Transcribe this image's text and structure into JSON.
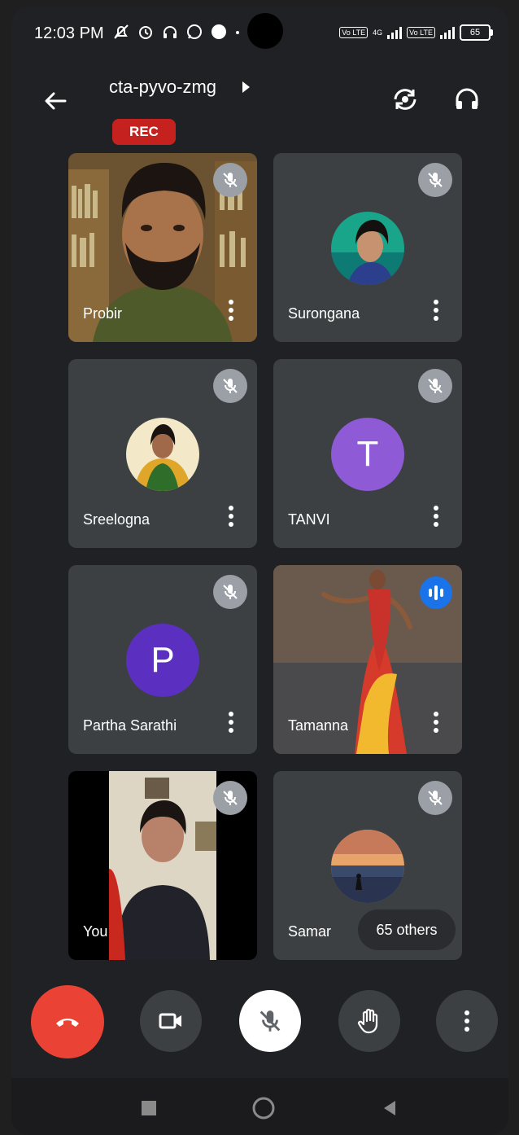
{
  "status_bar": {
    "time": "12:03 PM",
    "network": "4G",
    "lte": "Vo LTE",
    "battery": "65"
  },
  "header": {
    "meeting_code": "cta-pyvo-zmg",
    "rec_label": "REC"
  },
  "participants": [
    {
      "name": "Probir",
      "type": "video",
      "muted": true
    },
    {
      "name": "Surongana",
      "type": "photo",
      "muted": true
    },
    {
      "name": "Sreelogna",
      "type": "photo",
      "muted": true
    },
    {
      "name": "TANVI",
      "type": "letter",
      "letter": "T",
      "color": "#8e5ad6",
      "muted": true
    },
    {
      "name": "Partha Sarathi",
      "type": "letter",
      "letter": "P",
      "color": "#5b2fbf",
      "muted": true
    },
    {
      "name": "Tamanna",
      "type": "video",
      "muted": false,
      "speaking": true
    },
    {
      "name": "You",
      "type": "video",
      "muted": true
    },
    {
      "name": "Samar",
      "type": "photo",
      "muted": true,
      "others_label": "65 others"
    }
  ],
  "controls": {
    "end_call_color": "#ea4335",
    "icons": [
      "end-call-icon",
      "camera-icon",
      "mic-off-icon",
      "raise-hand-icon",
      "more-vert-icon"
    ]
  },
  "colors": {
    "background": "#202124",
    "tile": "#3c4043",
    "rec": "#c5221f",
    "speaking": "#1a73e8"
  }
}
